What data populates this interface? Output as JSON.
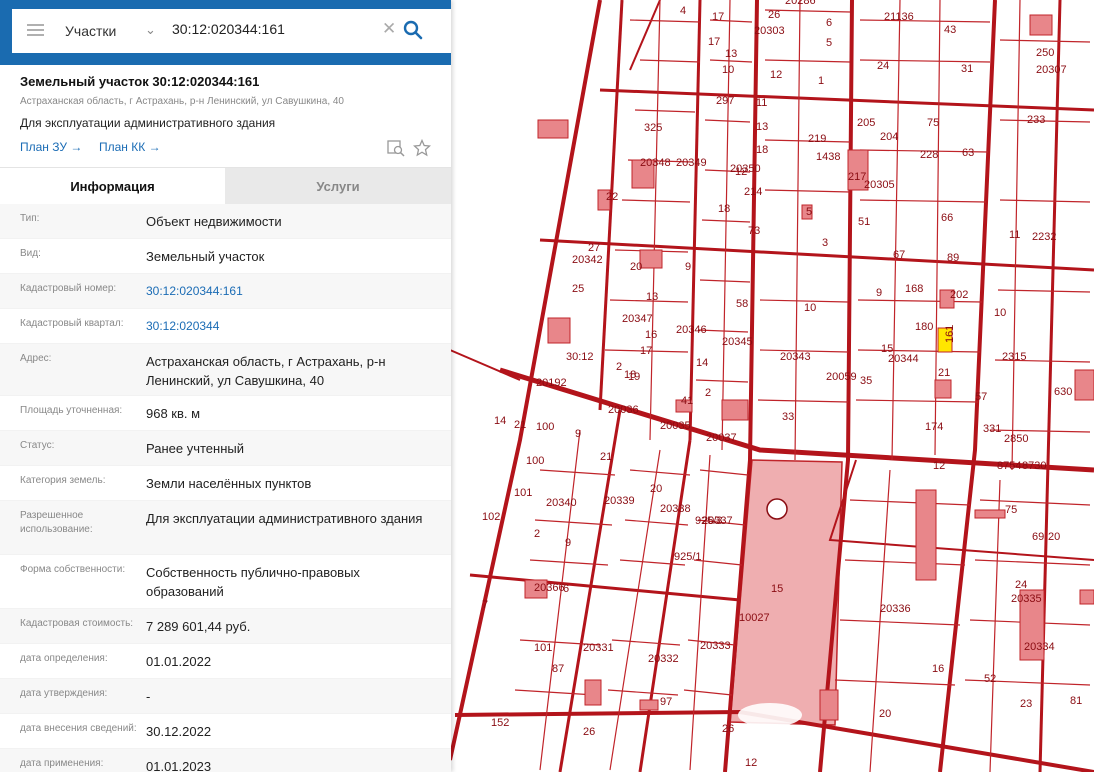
{
  "search": {
    "type_label": "Участки",
    "query": "30:12:020344:161"
  },
  "parcel": {
    "title": "Земельный участок 30:12:020344:161",
    "address_short": "Астраханская область, г Астрахань, р-н Ленинский, ул Савушкина, 40",
    "purpose": "Для эксплуатации административного здания",
    "plan_zu": "План ЗУ →",
    "plan_kk": "План КК →"
  },
  "tabs": {
    "info": "Информация",
    "services": "Услуги"
  },
  "rows": [
    {
      "key": "Тип:",
      "value": "Объект недвижимости"
    },
    {
      "key": "Вид:",
      "value": "Земельный участок"
    },
    {
      "key": "Кадастровый номер:",
      "value": "30:12:020344:161",
      "link": true
    },
    {
      "key": "Кадастровый квартал:",
      "value": "30:12:020344",
      "link": true
    },
    {
      "key": "Адрес:",
      "value": "Астраханская область, г Астрахань, р-н Ленинский, ул Савушкина, 40"
    },
    {
      "key": "Площадь уточненная:",
      "value": "968 кв. м"
    },
    {
      "key": "Статус:",
      "value": "Ранее учтенный"
    },
    {
      "key": "Категория земель:",
      "value": "Земли населённых пунктов"
    },
    {
      "key": "Разрешенное использование:",
      "value": "Для эксплуатации административного здания"
    },
    {
      "key": "Форма собственности:",
      "value": "Собственность публично-правовых образований"
    },
    {
      "key": "Кадастровая стоимость:",
      "value": "7 289 601,44 руб."
    },
    {
      "key": "дата определения:",
      "value": "01.01.2022"
    },
    {
      "key": "дата утверждения:",
      "value": "-"
    },
    {
      "key": "дата внесения сведений:",
      "value": "30.12.2022"
    },
    {
      "key": "дата применения:",
      "value": "01.01.2023"
    }
  ],
  "map": {
    "labels": [
      "4",
      "17",
      "26",
      "20286",
      "6",
      "5",
      "21136",
      "43",
      "17",
      "20303",
      "13",
      "10",
      "24",
      "31",
      "20307",
      "250",
      "1",
      "12",
      "11",
      "13",
      "297",
      "18",
      "219",
      "205",
      "75",
      "233",
      "325",
      "12",
      "20349",
      "1438",
      "204",
      "228",
      "20348",
      "20350",
      "217",
      "20305",
      "63",
      "22",
      "18",
      "214",
      "5",
      "51",
      "66",
      "73",
      "3",
      "11",
      "2232",
      "27",
      "20",
      "9",
      "67",
      "89",
      "20342",
      "13",
      "168",
      "202",
      "25",
      "58",
      "10",
      "9",
      "10",
      "20347",
      "20346",
      "20345",
      "180",
      "15",
      "16",
      "20343",
      "20344",
      "2315",
      "30:12",
      "17",
      "2",
      "20059",
      "35",
      "21",
      "20192",
      "18",
      "19",
      "14",
      "2",
      "33",
      "57",
      "100",
      "20036",
      "41",
      "174",
      "331",
      "2850",
      "21",
      "20035",
      "20037",
      "630",
      "14",
      "9",
      "21",
      "12",
      "8754",
      "8730",
      "101",
      "100",
      "20340",
      "20339",
      "20338",
      "20337",
      "2",
      "20",
      "75",
      "102",
      "9",
      "69",
      "925/3",
      "20",
      "925/1",
      "15",
      "20336",
      "20335",
      "20366",
      "6",
      "7",
      "24",
      "101",
      "20331",
      "20332",
      "20333",
      "20334",
      "87",
      "16",
      "52",
      "23",
      "81",
      "97",
      "20",
      "152",
      "26",
      "26",
      "12",
      "10027"
    ],
    "highlight_parcel": "161",
    "area_label": "30:12"
  },
  "colors": {
    "accent": "#1a6bb0",
    "link": "#1b6cb5",
    "parcel_line": "#c0242a",
    "building_fill": "#e8868a",
    "highlight": "#ffe600"
  },
  "icons": [
    "menu-icon",
    "chevron-down-icon",
    "close-icon",
    "search-icon",
    "collapse-arrow-icon",
    "preview-icon",
    "star-icon"
  ]
}
